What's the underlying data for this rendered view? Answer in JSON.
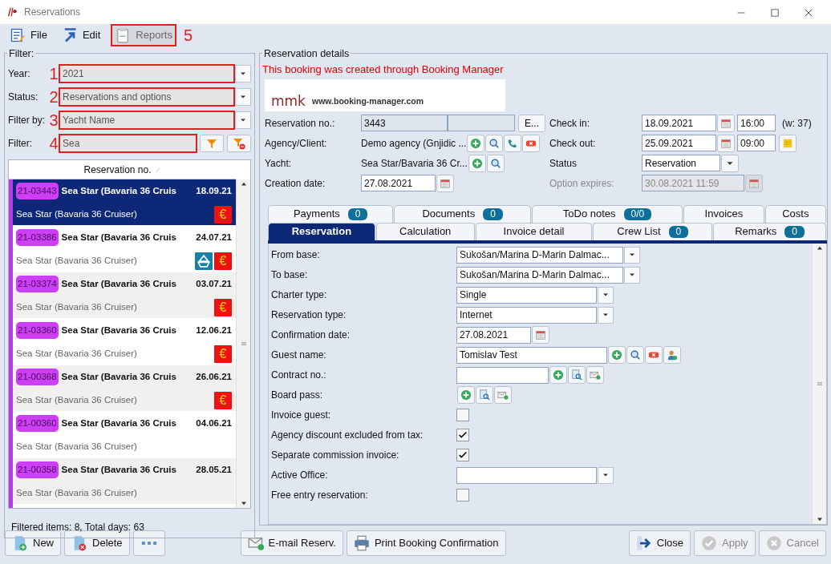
{
  "window": {
    "title": "Reservations"
  },
  "toolbar": [
    {
      "label": "File",
      "kind": "file",
      "disabled": false
    },
    {
      "label": "Edit",
      "kind": "edit",
      "disabled": false
    },
    {
      "label": "Reports",
      "kind": "report",
      "disabled": true,
      "callout": "5"
    }
  ],
  "filter": {
    "legend": "Filter:",
    "fields": [
      {
        "label": "Year:",
        "value": "2021",
        "kind": "select",
        "callout": "1"
      },
      {
        "label": "Status:",
        "value": "Reservations and options",
        "kind": "select",
        "callout": "2"
      },
      {
        "label": "Filter by:",
        "value": "Yacht Name",
        "kind": "select",
        "callout": "3"
      },
      {
        "label": "Filter:",
        "value": "Sea",
        "kind": "text",
        "callout": "4"
      }
    ]
  },
  "list": {
    "header": "Reservation no.",
    "rows": [
      {
        "number": "21-03443",
        "title": "Sea Star (Bavaria 36 Cruis",
        "date": "18.09.21",
        "subtitle": "Sea Star (Bavaria 36 Cruiser)",
        "selected": true,
        "marks": [
          {
            "kind": "currency",
            "symbol": "€"
          }
        ]
      },
      {
        "number": "21-03386",
        "title": "Sea Star (Bavaria 36 Cruis",
        "date": "24.07.21",
        "subtitle": "Sea Star (Bavaria 36 Cruiser)",
        "selected": false,
        "marks": [
          {
            "kind": "boat"
          },
          {
            "kind": "currency",
            "symbol": "€"
          }
        ]
      },
      {
        "number": "21-03374",
        "title": "Sea Star (Bavaria 36 Cruis",
        "date": "03.07.21",
        "subtitle": "Sea Star (Bavaria 36 Cruiser)",
        "selected": false,
        "marks": [
          {
            "kind": "currency",
            "symbol": "€"
          }
        ]
      },
      {
        "number": "21-03360",
        "title": "Sea Star (Bavaria 36 Cruis",
        "date": "12.06.21",
        "subtitle": "Sea Star (Bavaria 36 Cruiser)",
        "selected": false,
        "marks": [
          {
            "kind": "currency",
            "symbol": "€"
          }
        ]
      },
      {
        "number": "21-00368",
        "title": "Sea Star (Bavaria 36 Cruis",
        "date": "26.06.21",
        "subtitle": "Sea Star (Bavaria 36 Cruiser)",
        "selected": false,
        "marks": [
          {
            "kind": "currency",
            "symbol": "€"
          }
        ]
      },
      {
        "number": "21-00360",
        "title": "Sea Star (Bavaria 36 Cruis",
        "date": "04.06.21",
        "subtitle": "Sea Star (Bavaria 36 Cruiser)",
        "selected": false
      },
      {
        "number": "21-00358",
        "title": "Sea Star (Bavaria 36 Cruis",
        "date": "28.05.21",
        "subtitle": "Sea Star (Bavaria 36 Cruiser)",
        "selected": false
      }
    ],
    "footer": "Filtered items: 8,  Total days: 63"
  },
  "details": {
    "legend": "Reservation details",
    "notice": "This booking was created through Booking Manager",
    "logo": {
      "brand": "mmk",
      "url": "www.booking-manager.com"
    },
    "reservation_no": {
      "label": "Reservation no.:",
      "value": "3443",
      "button": "E..."
    },
    "agency": {
      "label": "Agency/Client:",
      "value": "Demo agency (Gnjidic ..."
    },
    "yacht": {
      "label": "Yacht:",
      "value": "Sea Star/Bavaria 36 Cr..."
    },
    "creation_date": {
      "label": "Creation date:",
      "value": "27.08.2021"
    },
    "check_in": {
      "label": "Check in:",
      "date": "18.09.2021",
      "time": "16:00",
      "week": "(w: 37)"
    },
    "check_out": {
      "label": "Check out:",
      "date": "25.09.2021",
      "time": "09:00"
    },
    "status": {
      "label": "Status",
      "value": "Reservation"
    },
    "option_expires": {
      "label": "Option expires:",
      "value": "30.08.2021 11:59",
      "disabled": true
    }
  },
  "tabs": [
    [
      {
        "label": "Payments",
        "count": "0",
        "selected": false
      },
      {
        "label": "Documents",
        "count": "0",
        "selected": false
      },
      {
        "label": "ToDo notes",
        "count": "0/0",
        "selected": false
      },
      {
        "label": "Invoices",
        "selected": false
      },
      {
        "label": "Costs",
        "selected": false
      }
    ],
    [
      {
        "label": "Reservation",
        "selected": true
      },
      {
        "label": "Calculation",
        "selected": false
      },
      {
        "label": "Invoice detail",
        "selected": false
      },
      {
        "label": "Crew List",
        "count": "0",
        "selected": false
      },
      {
        "label": "Remarks",
        "count": "0",
        "selected": false
      }
    ]
  ],
  "form": [
    {
      "label": "From base:",
      "kind": "select",
      "value": "Sukošan/Marina D-Marin Dalmac..."
    },
    {
      "label": "To base:",
      "kind": "select",
      "value": "Sukošan/Marina D-Marin Dalmac..."
    },
    {
      "label": "Charter type:",
      "kind": "select",
      "value": "Single"
    },
    {
      "label": "Reservation type:",
      "kind": "select",
      "value": "Internet"
    },
    {
      "label": "Confirmation date:",
      "kind": "date",
      "value": "27.08.2021"
    },
    {
      "label": "Guest name:",
      "kind": "text",
      "value": "Tomislav Test",
      "buttons": [
        {
          "kind": "add"
        },
        {
          "kind": "search"
        },
        {
          "kind": "delete"
        },
        {
          "kind": "user"
        }
      ]
    },
    {
      "label": "Contract no.:",
      "kind": "text",
      "buttons": [
        {
          "kind": "add"
        },
        {
          "kind": "find-doc"
        },
        {
          "kind": "attach"
        }
      ]
    },
    {
      "label": "Board pass:",
      "kind": "buttons",
      "buttons": [
        {
          "kind": "add"
        },
        {
          "kind": "find-doc"
        },
        {
          "kind": "attach"
        }
      ]
    },
    {
      "label": "Invoice guest:",
      "kind": "check",
      "checked": false
    },
    {
      "label": "Agency discount excluded from tax:",
      "kind": "check",
      "checked": true
    },
    {
      "label": "Separate commission invoice:",
      "kind": "check",
      "checked": true
    },
    {
      "label": "Active Office:",
      "kind": "select"
    },
    {
      "label": "Free entry reservation:",
      "kind": "check",
      "checked": false
    }
  ],
  "buttons": [
    {
      "label": "New",
      "kind": "new",
      "disabled": false
    },
    {
      "label": "Delete",
      "kind": "delete-doc",
      "disabled": false
    },
    {
      "kind": "more"
    },
    {
      "label": "E-mail Reserv.",
      "kind": "mail",
      "disabled": false
    },
    {
      "label": "Print Booking Confirmation",
      "kind": "print",
      "disabled": false
    },
    {
      "label": "Close",
      "kind": "close",
      "disabled": false
    },
    {
      "label": "Apply",
      "kind": "apply",
      "disabled": true
    },
    {
      "label": "Cancel",
      "kind": "cancel",
      "disabled": true
    }
  ]
}
